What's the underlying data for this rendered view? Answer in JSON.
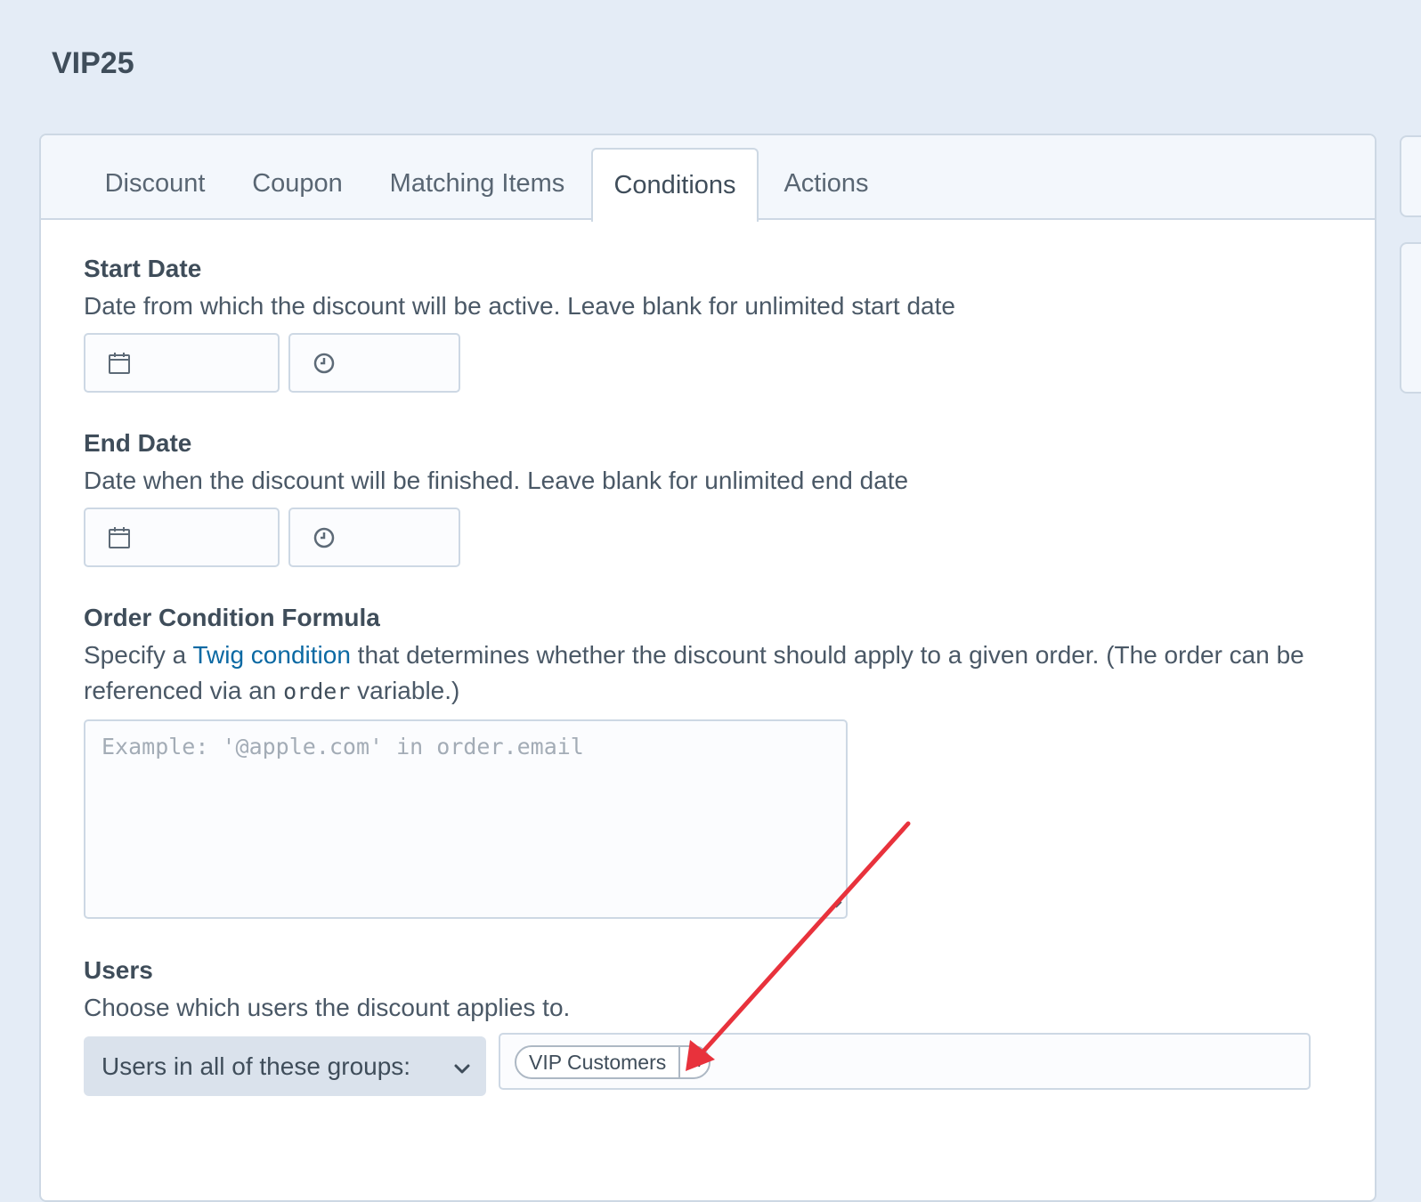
{
  "page": {
    "title": "VIP25"
  },
  "tabs": [
    {
      "label": "Discount"
    },
    {
      "label": "Coupon"
    },
    {
      "label": "Matching Items"
    },
    {
      "label": "Conditions",
      "active": true
    },
    {
      "label": "Actions"
    }
  ],
  "start_date": {
    "label": "Start Date",
    "instructions": "Date from which the discount will be active. Leave blank for unlimited start date",
    "date_icon": "calendar-icon",
    "time_icon": "clock-icon"
  },
  "end_date": {
    "label": "End Date",
    "instructions": "Date when the discount will be finished. Leave blank for unlimited end date",
    "date_icon": "calendar-icon",
    "time_icon": "clock-icon"
  },
  "order_condition": {
    "label": "Order Condition Formula",
    "instructions_prefix": "Specify a ",
    "link_text": "Twig condition",
    "instructions_middle": " that determines whether the discount should apply to a given order. (The order can be referenced via an ",
    "code_text": "order",
    "instructions_suffix": " variable.)",
    "placeholder": "Example: '@apple.com' in order.email",
    "value": ""
  },
  "users": {
    "label": "Users",
    "instructions": "Choose which users the discount applies to.",
    "select_value": "Users in all of these groups:",
    "groups": [
      {
        "label": "VIP Customers",
        "remove_icon": "x-icon"
      }
    ]
  },
  "annotation": {
    "arrow_color": "#e8323c"
  },
  "colors": {
    "link": "#0b69a3",
    "border": "#cdd8e4",
    "background": "#e4ecf6"
  }
}
